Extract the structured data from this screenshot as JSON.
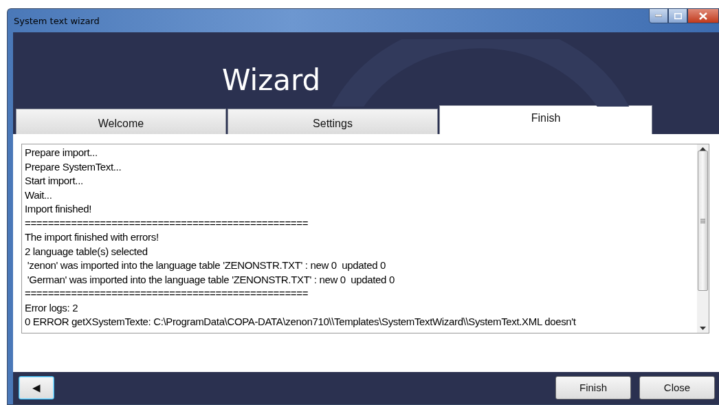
{
  "window": {
    "title": "System text wizard"
  },
  "header": {
    "title": "Wizard"
  },
  "tabs": [
    {
      "label": "Welcome",
      "selected": false
    },
    {
      "label": "Settings",
      "selected": false
    },
    {
      "label": "Finish",
      "selected": true
    }
  ],
  "log": {
    "lines": [
      "Prepare import...",
      "Prepare SystemText...",
      "Start import...",
      "Wait...",
      "Import finished!",
      "=================================================",
      "The import finished with errors!",
      "2 language table(s) selected",
      " 'zenon' was imported into the language table 'ZENONSTR.TXT' : new 0  updated 0",
      " 'German' was imported into the language table 'ZENONSTR.TXT' : new 0  updated 0",
      "=================================================",
      "Error logs: 2",
      "0 ERROR getXSystemTexte: C:\\ProgramData\\COPA-DATA\\zenon710\\\\Templates\\SystemTextWizard\\\\SystemText.XML doesn't"
    ]
  },
  "footer": {
    "back": "◀",
    "buttons": [
      "Finish",
      "Close"
    ]
  }
}
